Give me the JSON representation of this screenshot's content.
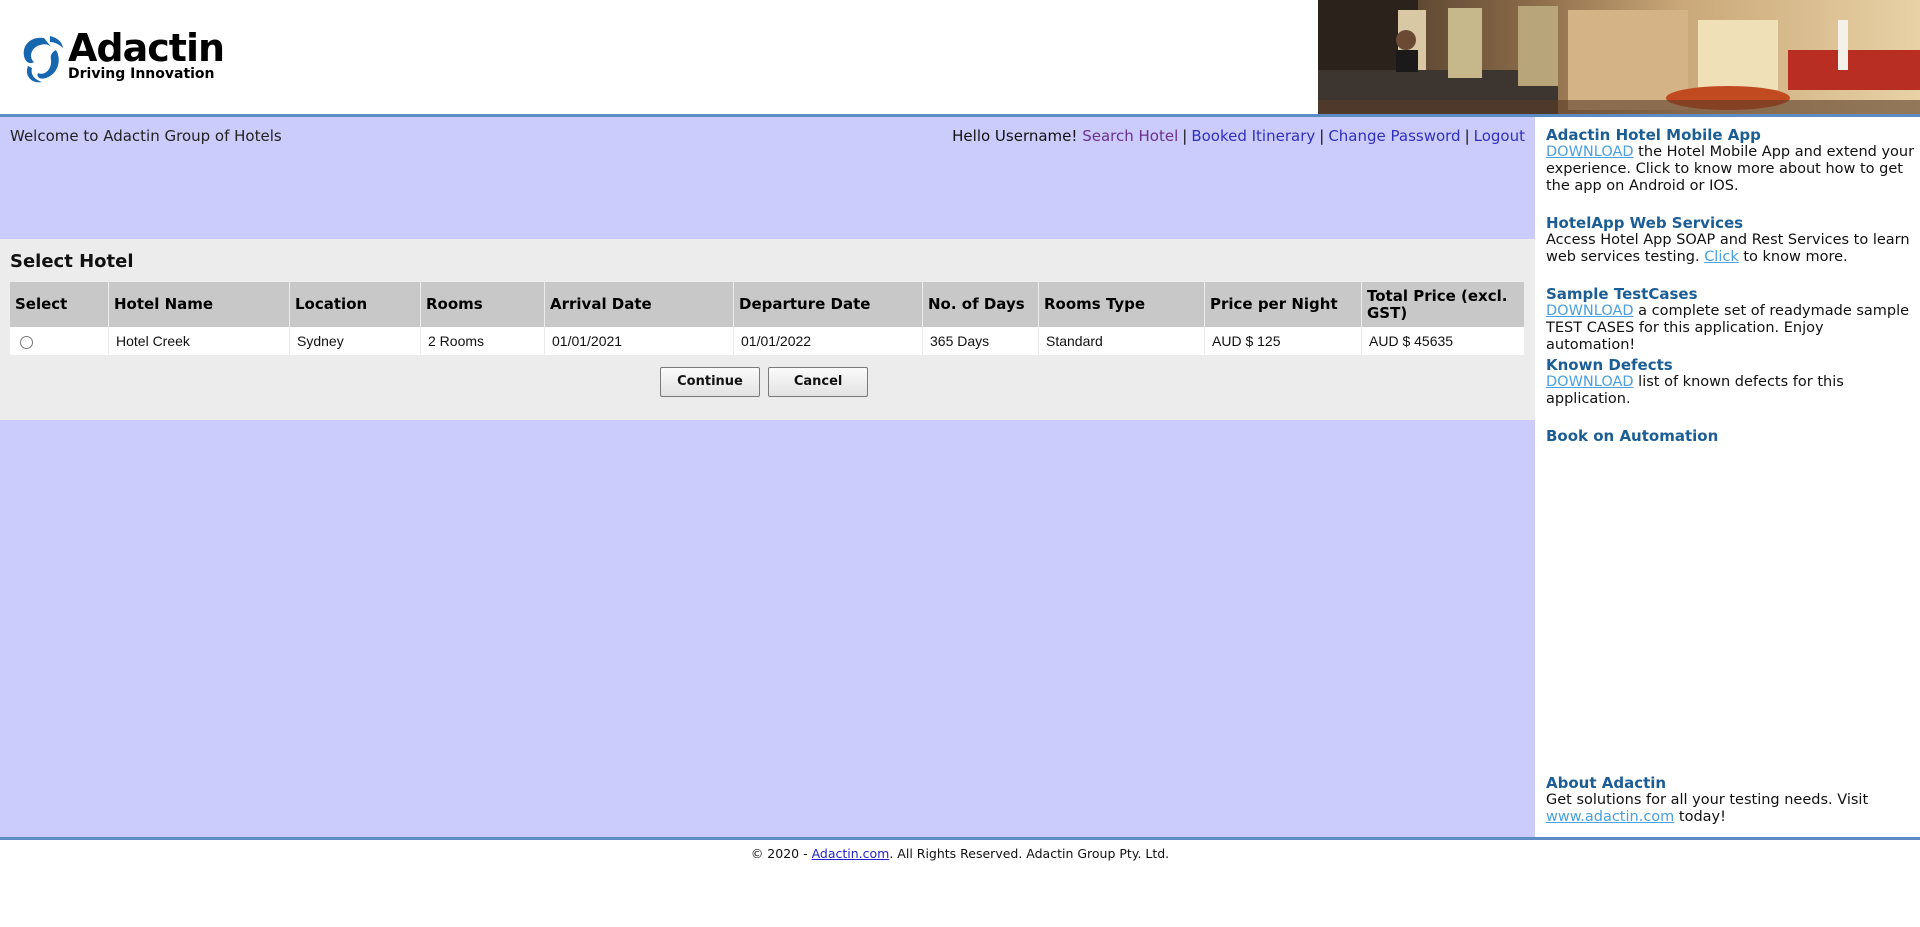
{
  "header": {
    "logo_text": "Adactin",
    "logo_tagline": "Driving Innovation"
  },
  "topbar": {
    "welcome": "Welcome to Adactin Group of Hotels",
    "greeting": "Hello Username!",
    "links": [
      "Search Hotel",
      "Booked Itinerary",
      "Change Password",
      "Logout"
    ]
  },
  "panel": {
    "title": "Select Hotel",
    "columns": [
      "Select",
      "Hotel Name",
      "Location",
      "Rooms",
      "Arrival Date",
      "Departure Date",
      "No. of Days",
      "Rooms Type",
      "Price per Night",
      "Total Price (excl. GST)"
    ],
    "rows": [
      {
        "hotel_name": "Hotel Creek",
        "location": "Sydney",
        "rooms": "2 Rooms",
        "arrival": "01/01/2021",
        "departure": "01/01/2022",
        "days": "365 Days",
        "room_type": "Standard",
        "price_per_night": "AUD $ 125",
        "total_price": "AUD $ 45635"
      }
    ],
    "continue_label": "Continue",
    "cancel_label": "Cancel"
  },
  "sidebar": {
    "mobile_app": {
      "title": "Adactin Hotel Mobile App",
      "link": "DOWNLOAD",
      "text": " the Hotel Mobile App and extend your experience. Click to know more about how to get the app on Android or IOS."
    },
    "web_services": {
      "title": "HotelApp Web Services",
      "text_before": "Access Hotel App SOAP and Rest Services to learn web services testing. ",
      "link": "Click",
      "text_after": " to know more."
    },
    "testcases": {
      "title": "Sample TestCases",
      "link": "DOWNLOAD",
      "text": " a complete set of readymade sample TEST CASES for this application. Enjoy automation!"
    },
    "defects": {
      "title": "Known Defects",
      "link": "DOWNLOAD",
      "text": " list of known defects for this application."
    },
    "book": {
      "title": "Book on Automation"
    },
    "about": {
      "title": "About Adactin",
      "text": "Get solutions for all your testing needs. Visit ",
      "link": "www.adactin.com",
      "text_after": " today!"
    }
  },
  "footer": {
    "prefix": "© 2020 - ",
    "link": "Adactin.com",
    "suffix": ". All Rights Reserved. Adactin Group Pty. Ltd."
  }
}
